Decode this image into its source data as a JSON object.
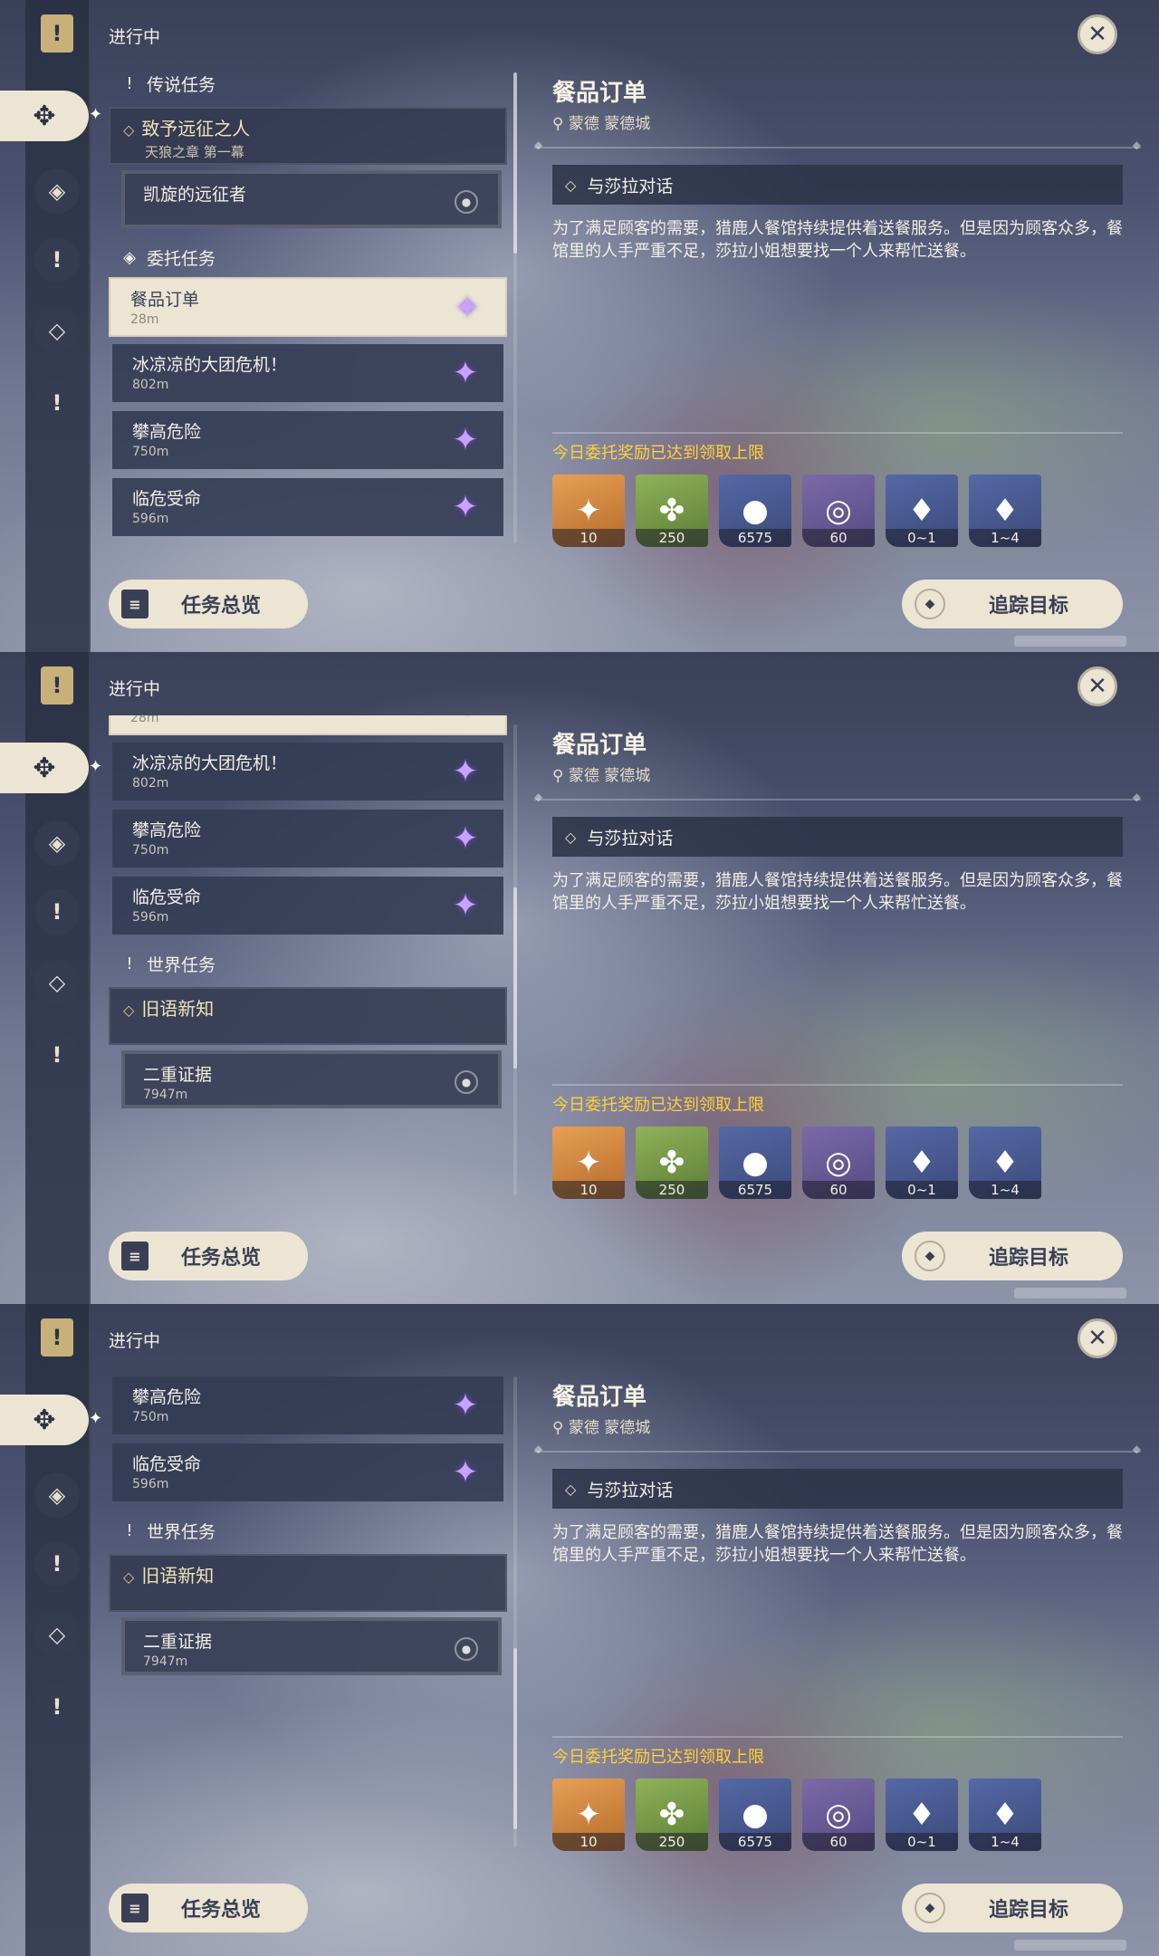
{
  "common": {
    "progress_label": "进行中",
    "close_symbol": "✕",
    "overview_label": "任务总览",
    "track_label": "追踪目标",
    "detail": {
      "title": "餐品订单",
      "location": "蒙德 蒙德城",
      "objective": "与莎拉对话",
      "description": "为了满足顾客的需要，猎鹿人餐馆持续提供着送餐服务。但是因为顾客众多，餐馆里的人手严重不足，莎拉小姐想要找一个人来帮忙送餐。",
      "reward_note": "今日委托奖励已达到领取上限",
      "rewards": [
        {
          "icon": "adventure-exp-icon",
          "count": "10"
        },
        {
          "icon": "companionship-exp-icon",
          "count": "250"
        },
        {
          "icon": "mora-icon",
          "count": "6575"
        },
        {
          "icon": "primogem-icon",
          "count": "60"
        },
        {
          "icon": "crystal-icon",
          "count": "0~1"
        },
        {
          "icon": "crystal-cluster-icon",
          "count": "1~4"
        }
      ]
    },
    "colors": {
      "accent_gold": "#ffd23a",
      "cream": "#ece5d4",
      "star_purple": "#c7a2ff"
    }
  },
  "categories": {
    "legend": "传说任务",
    "commission": "委托任务",
    "world": "世界任务"
  },
  "legend_quest": {
    "title": "致予远征之人",
    "chapter": "天狼之章 第一幕",
    "sub": "凯旋的远征者"
  },
  "commissions": [
    {
      "title": "餐品订单",
      "dist": "28m"
    },
    {
      "title": "冰凉凉的大团危机！",
      "dist": "802m"
    },
    {
      "title": "攀高危险",
      "dist": "750m"
    },
    {
      "title": "临危受命",
      "dist": "596m"
    }
  ],
  "world_quest": {
    "title": "旧语新知",
    "sub": "二重证据",
    "sub_dist": "7947m"
  },
  "panel_scroll": [
    "top",
    "middle",
    "bottom"
  ]
}
